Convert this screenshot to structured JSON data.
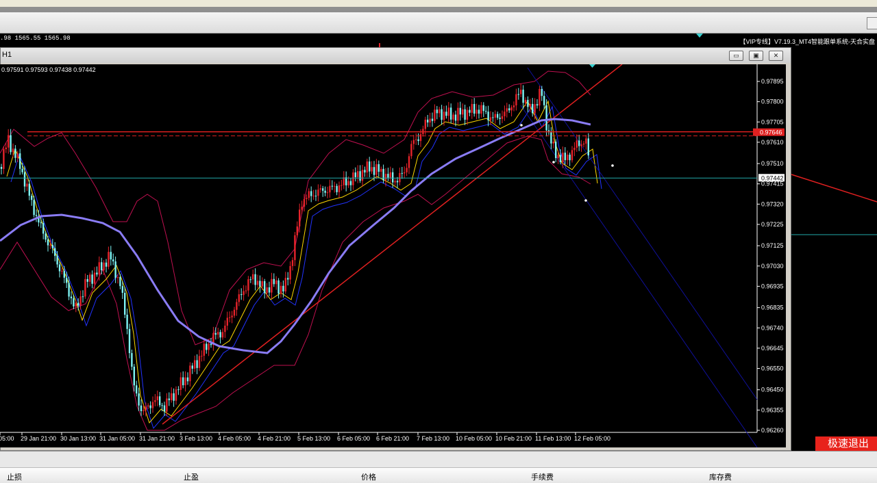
{
  "background": {
    "info_text": ".98 1565.55 1565.98",
    "vip_text": "【VIP专线】V7.19.3_MT4智能跟单系统-天合实盘"
  },
  "window": {
    "title": "H1",
    "buttons": {
      "minimize": "▭",
      "restore": "▣",
      "close": "✕"
    }
  },
  "chart": {
    "ohlc_text": "0.97591 0.97593 0.97438 0.97442",
    "price_labels": [
      "0.97895",
      "0.97800",
      "0.97705",
      "0.97610",
      "0.97510",
      "0.97415",
      "0.97320",
      "0.97225",
      "0.97125",
      "0.97030",
      "0.96935",
      "0.96835",
      "0.96740",
      "0.96645",
      "0.96550",
      "0.96450",
      "0.96355",
      "0.96260"
    ],
    "current_price": "0.97442",
    "red_line_price": "0.97646",
    "time_labels": [
      "05:00",
      "29 Jan 21:00",
      "30 Jan 13:00",
      "31 Jan 05:00",
      "31 Jan 21:00",
      "3 Feb 13:00",
      "4 Feb 05:00",
      "4 Feb 21:00",
      "5 Feb 13:00",
      "6 Feb 05:00",
      "6 Feb 21:00",
      "7 Feb 13:00",
      "10 Feb 05:00",
      "10 Feb 21:00",
      "11 Feb 13:00",
      "12 Feb 05:00"
    ],
    "colors": {
      "bull": "#e8232b",
      "bear": "#7ff5f5",
      "ma_slow": "#8a7cf5",
      "bollinger": "#c01050",
      "ma_fast1": "#ffd800",
      "ma_fast2": "#2233ff",
      "channel": "#10109a",
      "trend": "#e02020",
      "price_line": "#22aaaa"
    }
  },
  "sell_button": {
    "label": "极速退出"
  },
  "terminal": {
    "columns": [
      "止损",
      "止盈",
      "价格",
      "手续费",
      "库存费"
    ]
  }
}
